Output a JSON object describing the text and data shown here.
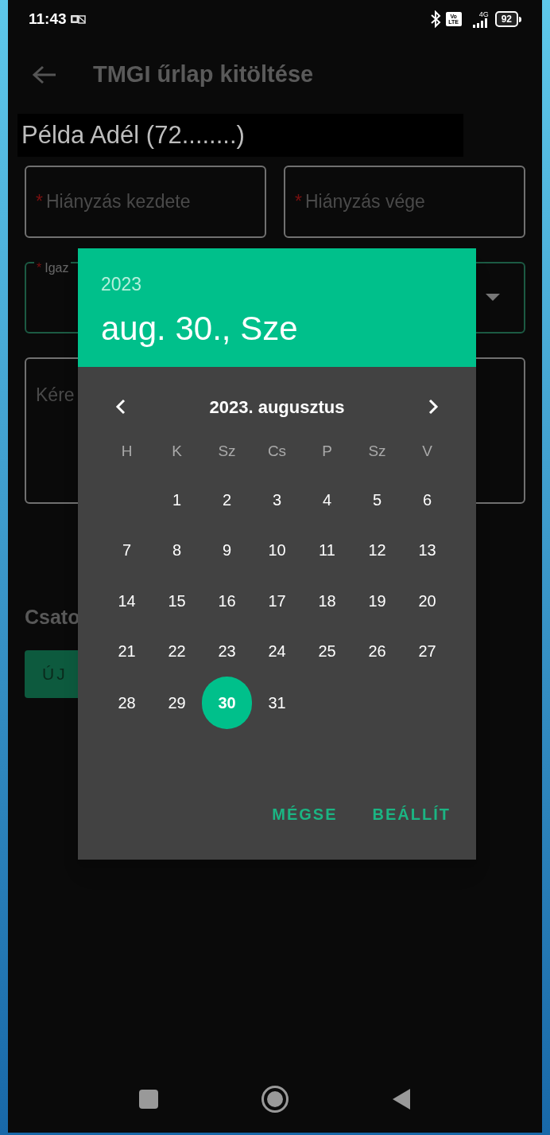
{
  "status_bar": {
    "time": "11:43",
    "volte": [
      "Vo",
      "LTE"
    ],
    "network": "4G",
    "battery": "92"
  },
  "app_bar": {
    "title": "TMGI űrlap kitöltése"
  },
  "person": {
    "name": "Példa Adél (72........)"
  },
  "form": {
    "date_fields": [
      {
        "marker": "*",
        "placeholder": "Hiányzás kezdete"
      },
      {
        "marker": "*",
        "placeholder": "Hiányzás vége"
      }
    ],
    "select": {
      "marker": "*",
      "label": "Igaz"
    },
    "textarea": {
      "placeholder": "Kére"
    },
    "attachments": {
      "heading": "Csato",
      "button": "ÚJ"
    }
  },
  "date_picker": {
    "year": "2023",
    "date": "aug. 30., Sze",
    "month": "2023. augusztus",
    "weekdays": [
      "H",
      "K",
      "Sz",
      "Cs",
      "P",
      "Sz",
      "V"
    ],
    "weeks": [
      [
        {
          "kind": "empty"
        },
        {
          "kind": "day",
          "label": "1",
          "selected": false
        },
        {
          "kind": "day",
          "label": "2",
          "selected": false
        },
        {
          "kind": "day",
          "label": "3",
          "selected": false
        },
        {
          "kind": "day",
          "label": "4",
          "selected": false
        },
        {
          "kind": "day",
          "label": "5",
          "selected": false
        },
        {
          "kind": "day",
          "label": "6",
          "selected": false
        }
      ],
      [
        {
          "kind": "day",
          "label": "7",
          "selected": false
        },
        {
          "kind": "day",
          "label": "8",
          "selected": false
        },
        {
          "kind": "day",
          "label": "9",
          "selected": false
        },
        {
          "kind": "day",
          "label": "10",
          "selected": false
        },
        {
          "kind": "day",
          "label": "11",
          "selected": false
        },
        {
          "kind": "day",
          "label": "12",
          "selected": false
        },
        {
          "kind": "day",
          "label": "13",
          "selected": false
        }
      ],
      [
        {
          "kind": "day",
          "label": "14",
          "selected": false
        },
        {
          "kind": "day",
          "label": "15",
          "selected": false
        },
        {
          "kind": "day",
          "label": "16",
          "selected": false
        },
        {
          "kind": "day",
          "label": "17",
          "selected": false
        },
        {
          "kind": "day",
          "label": "18",
          "selected": false
        },
        {
          "kind": "day",
          "label": "19",
          "selected": false
        },
        {
          "kind": "day",
          "label": "20",
          "selected": false
        }
      ],
      [
        {
          "kind": "day",
          "label": "21",
          "selected": false
        },
        {
          "kind": "day",
          "label": "22",
          "selected": false
        },
        {
          "kind": "day",
          "label": "23",
          "selected": false
        },
        {
          "kind": "day",
          "label": "24",
          "selected": false
        },
        {
          "kind": "day",
          "label": "25",
          "selected": false
        },
        {
          "kind": "day",
          "label": "26",
          "selected": false
        },
        {
          "kind": "day",
          "label": "27",
          "selected": false
        }
      ],
      [
        {
          "kind": "day",
          "label": "28",
          "selected": false
        },
        {
          "kind": "day",
          "label": "29",
          "selected": false
        },
        {
          "kind": "day",
          "label": "30",
          "selected": true
        },
        {
          "kind": "day",
          "label": "31",
          "selected": false
        }
      ]
    ],
    "actions": [
      "MÉGSE",
      "BEÁLLÍT"
    ]
  }
}
